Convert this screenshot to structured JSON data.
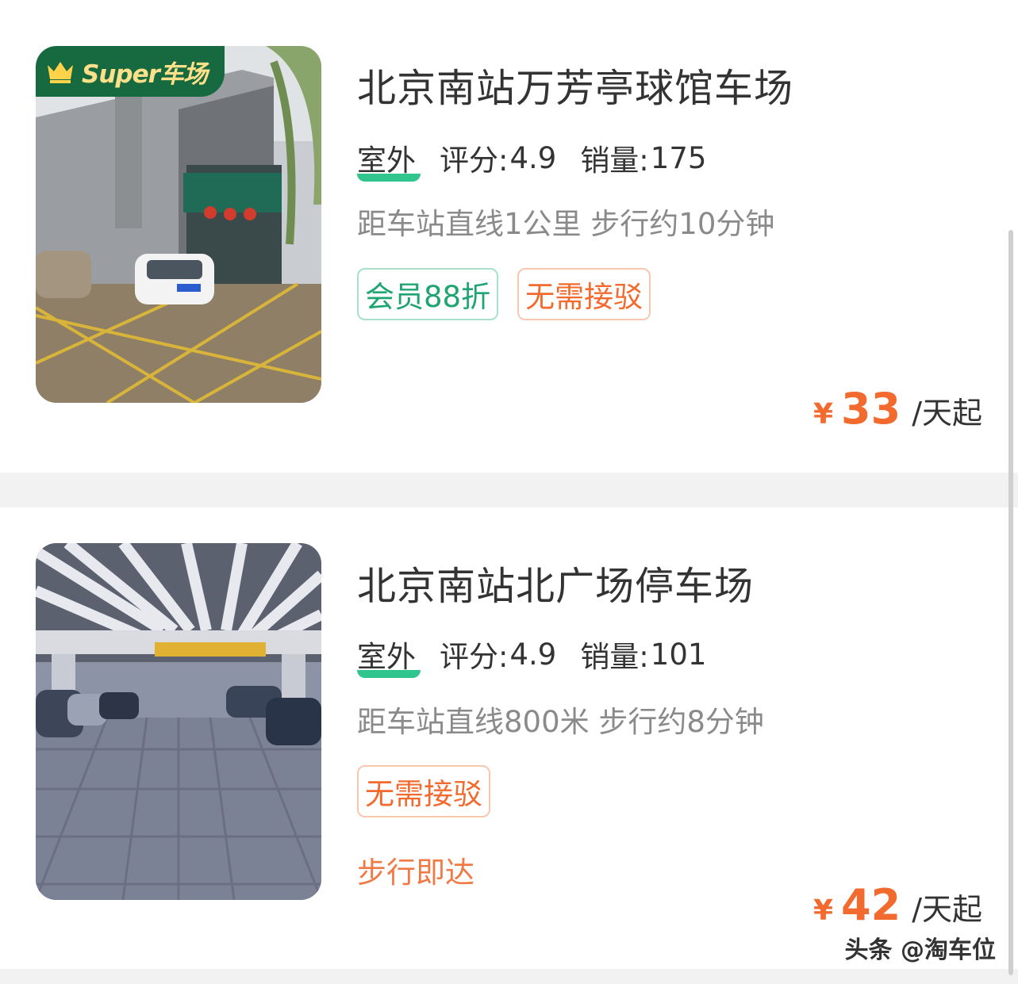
{
  "listings": [
    {
      "badge": "Super车场",
      "title": "北京南站万芳亭球馆车场",
      "environment": "室外",
      "rating_label": "评分:",
      "rating": "4.9",
      "sales_label": "销量:",
      "sales": "175",
      "distance": "距车站直线1公里 步行约10分钟",
      "tags": [
        "会员88折",
        "无需接驳"
      ],
      "price_currency": "¥",
      "price": "33",
      "price_unit": "/天起"
    },
    {
      "title": "北京南站北广场停车场",
      "environment": "室外",
      "rating_label": "评分:",
      "rating": "4.9",
      "sales_label": "销量:",
      "sales": "101",
      "distance": "距车站直线800米 步行约8分钟",
      "tags": [
        "无需接驳"
      ],
      "note": "步行即达",
      "price_currency": "¥",
      "price": "42",
      "price_unit": "/天起"
    }
  ],
  "watermark": "头条 @淘车位",
  "colors": {
    "accent_orange": "#f26a2e",
    "accent_green": "#1fa571",
    "badge_green": "#176a3f",
    "badge_text": "#ffe08a",
    "title_text": "#333333",
    "muted_text": "#8a8a8a"
  },
  "icons": {
    "badge_icon": "crown-icon"
  }
}
